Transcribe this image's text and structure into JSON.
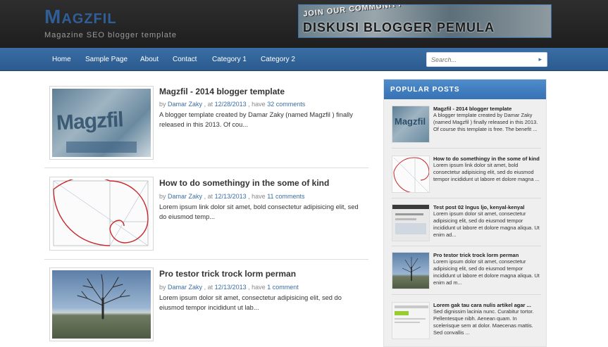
{
  "header": {
    "logo": "Magzfil",
    "tagline": "Magazine SEO blogger template",
    "banner": {
      "line1": "JOIN OUR COMMUNITY",
      "line2": "DISKUSI BLOGGER PEMULA"
    }
  },
  "nav": {
    "items": [
      "Home",
      "Sample Page",
      "About",
      "Contact",
      "Category 1",
      "Category 2"
    ]
  },
  "search": {
    "placeholder": "Search...",
    "go_icon": "▸"
  },
  "posts": [
    {
      "title": "Magzfil - 2014 blogger template",
      "by": "by",
      "author": "Damar Zaky",
      "sep1": ", at",
      "date": "12/28/2013",
      "sep2": ", have",
      "comments": "32 comments",
      "excerpt": "A blogger template created by Damar Zaky (named Magzfil ) finally released in this 2013. Of cou..."
    },
    {
      "title": "How to do somethingy in the some of kind",
      "by": "by",
      "author": "Damar Zaky",
      "sep1": ", at",
      "date": "12/13/2013",
      "sep2": ", have",
      "comments": "11 comments",
      "excerpt": "Lorem ipsum link dolor sit amet, bold consectetur adipisicing elit, sed do eiusmod temp..."
    },
    {
      "title": "Pro testor trick trock lorm perman",
      "by": "by",
      "author": "Damar Zaky",
      "sep1": ", at",
      "date": "12/13/2013",
      "sep2": ", have",
      "comments": "1 comment",
      "excerpt": "Lorem ipsum dolor sit amet, consectetur adipisicing elit, sed do eiusmod tempor incididunt ut lab..."
    }
  ],
  "sidebar": {
    "title": "POPULAR POSTS",
    "items": [
      {
        "title": "Magzfil - 2014 blogger template",
        "text": "A blogger template created by Damar Zaky (named Magzfil ) finally released in this 2013. Of course this template is free. The benefit ..."
      },
      {
        "title": "How to do somethingy in the some of kind",
        "text": "Lorem ipsum link dolor sit amet, bold consectetur adipisicing elit, sed do eiusmod tempor incididunt ut labore et dolore magna ..."
      },
      {
        "title": "Test post 02 lngus ljo, kenyal-kenyal",
        "text": "Lorem ipsum dolor sit amet, consectetur adipisicing elit, sed do eiusmod tempor incididunt ut labore et dolore magna aliqua. Ut enim ad..."
      },
      {
        "title": "Pro testor trick trock lorm perman",
        "text": "Lorem ipsum dolor sit amet, consectetur adipisicing elit, sed do eiusmod tempor incididunt ut labore et dolore magna aliqua. Ut enim ad m..."
      },
      {
        "title": "Lorem gak tau cara nulis artikel agar ...",
        "text": "Sed dignissim lacinia nunc. Curabitur tortor. Pellentesque nibh. Aenean quam. In scelerisque sem at dolor. Maecenas mattis. Sed convallis ..."
      }
    ]
  }
}
